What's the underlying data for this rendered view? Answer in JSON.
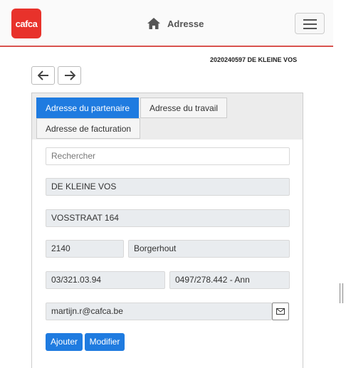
{
  "header": {
    "logo_text": "cafca",
    "title": "Adresse",
    "home_icon": "home-icon",
    "menu_icon": "hamburger-menu-icon",
    "accent_color": "#d9534f"
  },
  "record": {
    "id_label": "2020240597 DE KLEINE VOS"
  },
  "nav": {
    "back_icon": "arrow-left-icon",
    "forward_icon": "arrow-right-icon"
  },
  "tabs": [
    {
      "label": "Adresse du partenaire",
      "active": true
    },
    {
      "label": "Adresse du travail",
      "active": false
    },
    {
      "label": "Adresse de facturation",
      "active": false
    }
  ],
  "form": {
    "search_placeholder": "Rechercher",
    "name": "DE KLEINE VOS",
    "street": "VOSSTRAAT 164",
    "postcode": "2140",
    "city": "Borgerhout",
    "phone": "03/321.03.94",
    "mobile": "0497/278.442 - Ann",
    "email": "martijn.r@cafca.be",
    "email_icon": "envelope-icon"
  },
  "actions": {
    "add_label": "Ajouter",
    "edit_label": "Modifier",
    "primary_color": "#1f7be0"
  }
}
